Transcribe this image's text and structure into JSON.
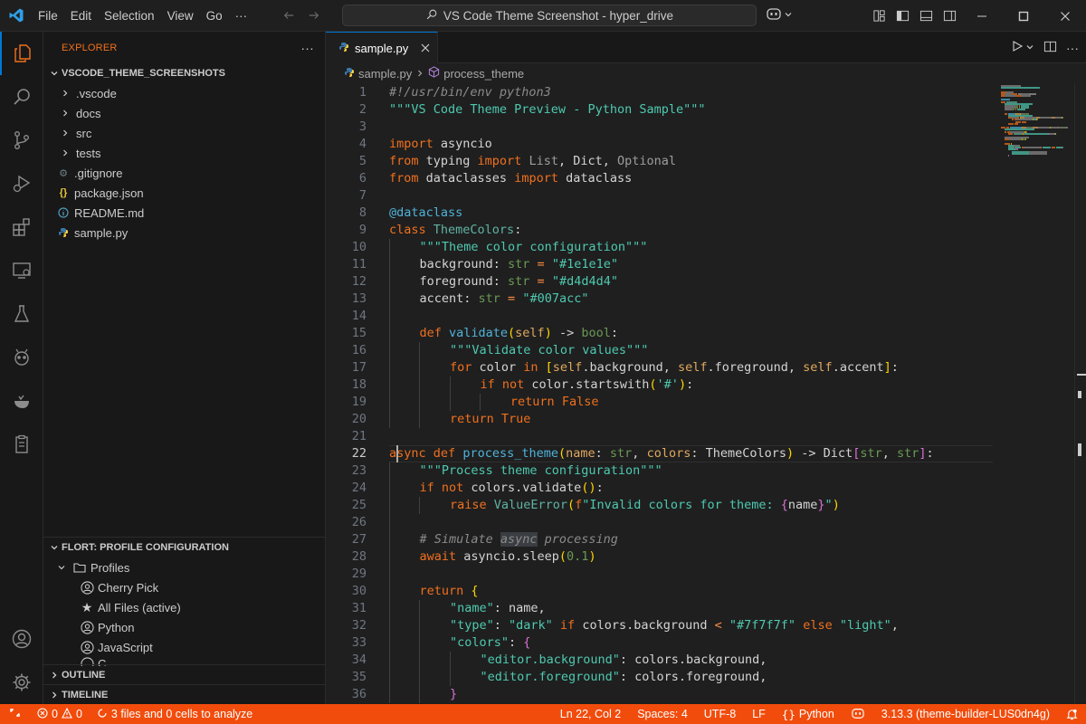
{
  "titlebar": {
    "menu": [
      "File",
      "Edit",
      "Selection",
      "View",
      "Go"
    ],
    "more": "···",
    "search_text": "VS Code Theme Screenshot - hyper_drive"
  },
  "sidebar": {
    "title": "EXPLORER",
    "more": "···",
    "workspace": "VSCODE_THEME_SCREENSHOTS",
    "items": [
      {
        "label": ".vscode",
        "type": "folder"
      },
      {
        "label": "docs",
        "type": "folder"
      },
      {
        "label": "src",
        "type": "folder"
      },
      {
        "label": "tests",
        "type": "folder"
      },
      {
        "label": ".gitignore",
        "type": "file",
        "icon": "gear-file"
      },
      {
        "label": "package.json",
        "type": "file",
        "icon": "json-braces"
      },
      {
        "label": "README.md",
        "type": "file",
        "icon": "info-circle"
      },
      {
        "label": "sample.py",
        "type": "file",
        "icon": "python"
      }
    ],
    "flort": {
      "title": "FLORT: PROFILE CONFIGURATION",
      "group": "Profiles",
      "profiles": [
        {
          "label": "Cherry Pick",
          "icon": "account-circle"
        },
        {
          "label": "All Files (active)",
          "icon": "star"
        },
        {
          "label": "Python",
          "icon": "account-circle"
        },
        {
          "label": "JavaScript",
          "icon": "account-circle"
        },
        {
          "label": "C",
          "icon": "account-circle"
        }
      ]
    },
    "outline": "OUTLINE",
    "timeline": "TIMELINE"
  },
  "editor": {
    "tab": "sample.py",
    "breadcrumb": [
      "sample.py",
      "process_theme"
    ],
    "current_line": 22,
    "lines": [
      {
        "n": 1,
        "i": 0,
        "t": [
          [
            "#!/usr/bin/env python3",
            "cm"
          ]
        ]
      },
      {
        "n": 2,
        "i": 0,
        "t": [
          [
            "\"\"\"VS Code Theme Preview - Python Sample\"\"\"",
            "str"
          ]
        ]
      },
      {
        "n": 3,
        "i": 0,
        "t": []
      },
      {
        "n": 4,
        "i": 0,
        "t": [
          [
            "import",
            "kw"
          ],
          [
            " asyncio",
            ""
          ]
        ]
      },
      {
        "n": 5,
        "i": 0,
        "t": [
          [
            "from",
            "kw"
          ],
          [
            " typing ",
            ""
          ],
          [
            "import",
            "kw"
          ],
          [
            " ",
            ""
          ],
          [
            "List",
            "dim"
          ],
          [
            ", ",
            ""
          ],
          [
            "Dict",
            ""
          ],
          [
            ", ",
            ""
          ],
          [
            "Optional",
            "dim"
          ]
        ]
      },
      {
        "n": 6,
        "i": 0,
        "t": [
          [
            "from",
            "kw"
          ],
          [
            " dataclasses ",
            ""
          ],
          [
            "import",
            "kw"
          ],
          [
            " dataclass",
            ""
          ]
        ]
      },
      {
        "n": 7,
        "i": 0,
        "t": []
      },
      {
        "n": 8,
        "i": 0,
        "t": [
          [
            "@dataclass",
            "dec"
          ]
        ]
      },
      {
        "n": 9,
        "i": 0,
        "t": [
          [
            "class",
            "kw"
          ],
          [
            " ",
            ""
          ],
          [
            "ThemeColors",
            "cls"
          ],
          [
            ":",
            ""
          ]
        ]
      },
      {
        "n": 10,
        "i": 1,
        "t": [
          [
            "\"\"\"Theme color configuration\"\"\"",
            "str"
          ]
        ]
      },
      {
        "n": 11,
        "i": 1,
        "t": [
          [
            "background",
            ""
          ],
          [
            ": ",
            ""
          ],
          [
            "str",
            "typ"
          ],
          [
            " ",
            ""
          ],
          [
            "=",
            "op"
          ],
          [
            " ",
            ""
          ],
          [
            "\"#1e1e1e\"",
            "str"
          ]
        ]
      },
      {
        "n": 12,
        "i": 1,
        "t": [
          [
            "foreground",
            ""
          ],
          [
            ": ",
            ""
          ],
          [
            "str",
            "typ"
          ],
          [
            " ",
            ""
          ],
          [
            "=",
            "op"
          ],
          [
            " ",
            ""
          ],
          [
            "\"#d4d4d4\"",
            "str"
          ]
        ]
      },
      {
        "n": 13,
        "i": 1,
        "t": [
          [
            "accent",
            ""
          ],
          [
            ": ",
            ""
          ],
          [
            "str",
            "typ"
          ],
          [
            " ",
            ""
          ],
          [
            "=",
            "op"
          ],
          [
            " ",
            ""
          ],
          [
            "\"#007acc\"",
            "str"
          ]
        ]
      },
      {
        "n": 14,
        "i": 0,
        "t": []
      },
      {
        "n": 15,
        "i": 1,
        "t": [
          [
            "def",
            "kw"
          ],
          [
            " ",
            ""
          ],
          [
            "validate",
            "fn"
          ],
          [
            "(",
            "p1"
          ],
          [
            "self",
            "par"
          ],
          [
            ")",
            "p1"
          ],
          [
            " -> ",
            ""
          ],
          [
            "bool",
            "typ"
          ],
          [
            ":",
            ""
          ]
        ]
      },
      {
        "n": 16,
        "i": 2,
        "t": [
          [
            "\"\"\"Validate color values\"\"\"",
            "str"
          ]
        ]
      },
      {
        "n": 17,
        "i": 2,
        "t": [
          [
            "for",
            "ctl"
          ],
          [
            " color ",
            ""
          ],
          [
            "in",
            "ctl"
          ],
          [
            " ",
            ""
          ],
          [
            "[",
            "p1"
          ],
          [
            "self",
            "par"
          ],
          [
            ".background, ",
            ""
          ],
          [
            "self",
            "par"
          ],
          [
            ".foreground, ",
            ""
          ],
          [
            "self",
            "par"
          ],
          [
            ".accent",
            ""
          ],
          [
            "]",
            "p1"
          ],
          [
            ":",
            ""
          ]
        ]
      },
      {
        "n": 18,
        "i": 3,
        "t": [
          [
            "if",
            "ctl"
          ],
          [
            " ",
            ""
          ],
          [
            "not",
            "ctl"
          ],
          [
            " color.startswith",
            ""
          ],
          [
            "(",
            "p1"
          ],
          [
            "'#'",
            "str"
          ],
          [
            ")",
            "p1"
          ],
          [
            ":",
            ""
          ]
        ]
      },
      {
        "n": 19,
        "i": 4,
        "t": [
          [
            "return",
            "ctl"
          ],
          [
            " ",
            ""
          ],
          [
            "False",
            "kw"
          ]
        ]
      },
      {
        "n": 20,
        "i": 2,
        "t": [
          [
            "return",
            "ctl"
          ],
          [
            " ",
            ""
          ],
          [
            "True",
            "kw"
          ]
        ]
      },
      {
        "n": 21,
        "i": 0,
        "t": []
      },
      {
        "n": 22,
        "i": 0,
        "t": [
          [
            "async",
            "kw"
          ],
          [
            " ",
            ""
          ],
          [
            "def",
            "kw"
          ],
          [
            " ",
            ""
          ],
          [
            "process_theme",
            "fn"
          ],
          [
            "(",
            "p1"
          ],
          [
            "name",
            "par"
          ],
          [
            ": ",
            ""
          ],
          [
            "str",
            "typ"
          ],
          [
            ", ",
            ""
          ],
          [
            "colors",
            "par"
          ],
          [
            ": ",
            ""
          ],
          [
            "ThemeColors",
            ""
          ],
          [
            ")",
            "p1"
          ],
          [
            " -> ",
            ""
          ],
          [
            "Dict",
            ""
          ],
          [
            "[",
            "p2"
          ],
          [
            "str",
            "typ"
          ],
          [
            ", ",
            ""
          ],
          [
            "str",
            "typ"
          ],
          [
            "]",
            "p2"
          ],
          [
            ":",
            ""
          ]
        ]
      },
      {
        "n": 23,
        "i": 1,
        "t": [
          [
            "\"\"\"Process theme configuration\"\"\"",
            "str"
          ]
        ]
      },
      {
        "n": 24,
        "i": 1,
        "t": [
          [
            "if",
            "ctl"
          ],
          [
            " ",
            ""
          ],
          [
            "not",
            "ctl"
          ],
          [
            " colors.validate",
            ""
          ],
          [
            "()",
            "p1"
          ],
          [
            ":",
            ""
          ]
        ]
      },
      {
        "n": 25,
        "i": 2,
        "t": [
          [
            "raise",
            "ctl"
          ],
          [
            " ",
            ""
          ],
          [
            "ValueError",
            "cls"
          ],
          [
            "(",
            "p1"
          ],
          [
            "f",
            "kw"
          ],
          [
            "\"Invalid colors for theme: ",
            "str"
          ],
          [
            "{",
            "p2"
          ],
          [
            "name",
            ""
          ],
          [
            "}",
            "p2"
          ],
          [
            "\"",
            "str"
          ],
          [
            ")",
            "p1"
          ]
        ]
      },
      {
        "n": 26,
        "i": 0,
        "t": []
      },
      {
        "n": 27,
        "i": 1,
        "t": [
          [
            "# Simulate ",
            "cm"
          ],
          [
            "async",
            "cm hl"
          ],
          [
            " processing",
            "cm"
          ]
        ]
      },
      {
        "n": 28,
        "i": 1,
        "t": [
          [
            "await",
            "ctl"
          ],
          [
            " asyncio.sleep",
            ""
          ],
          [
            "(",
            "p1"
          ],
          [
            "0.1",
            "num"
          ],
          [
            ")",
            "p1"
          ]
        ]
      },
      {
        "n": 29,
        "i": 0,
        "t": []
      },
      {
        "n": 30,
        "i": 1,
        "t": [
          [
            "return",
            "ctl"
          ],
          [
            " ",
            ""
          ],
          [
            "{",
            "p1"
          ]
        ]
      },
      {
        "n": 31,
        "i": 2,
        "t": [
          [
            "\"name\"",
            "str"
          ],
          [
            ": name,",
            ""
          ]
        ]
      },
      {
        "n": 32,
        "i": 2,
        "t": [
          [
            "\"type\"",
            "str"
          ],
          [
            ": ",
            ""
          ],
          [
            "\"dark\"",
            "str"
          ],
          [
            " ",
            ""
          ],
          [
            "if",
            "ctl"
          ],
          [
            " colors.background ",
            ""
          ],
          [
            "<",
            "op"
          ],
          [
            " ",
            ""
          ],
          [
            "\"#7f7f7f\"",
            "str"
          ],
          [
            " ",
            ""
          ],
          [
            "else",
            "ctl"
          ],
          [
            " ",
            ""
          ],
          [
            "\"light\"",
            "str"
          ],
          [
            ",",
            ""
          ]
        ]
      },
      {
        "n": 33,
        "i": 2,
        "t": [
          [
            "\"colors\"",
            "str"
          ],
          [
            ": ",
            ""
          ],
          [
            "{",
            "p2"
          ]
        ]
      },
      {
        "n": 34,
        "i": 3,
        "t": [
          [
            "\"editor.background\"",
            "str"
          ],
          [
            ": colors.background,",
            ""
          ]
        ]
      },
      {
        "n": 35,
        "i": 3,
        "t": [
          [
            "\"editor.foreground\"",
            "str"
          ],
          [
            ": colors.foreground,",
            ""
          ]
        ]
      },
      {
        "n": 36,
        "i": 2,
        "t": [
          [
            "}",
            "p2"
          ]
        ]
      }
    ]
  },
  "statusbar": {
    "errors": "0",
    "warnings": "0",
    "analysis": "3 files and 0 cells to analyze",
    "position": "Ln 22, Col 2",
    "spaces": "Spaces: 4",
    "encoding": "UTF-8",
    "eol": "LF",
    "language": "Python",
    "interpreter": "3.13.3 (theme-builder-LUS0dn4g)"
  },
  "colors": {
    "accent": "#0078d4",
    "status_bar": "#f14c0c",
    "keyword": "#f0701e",
    "string": "#4ec9b0"
  }
}
